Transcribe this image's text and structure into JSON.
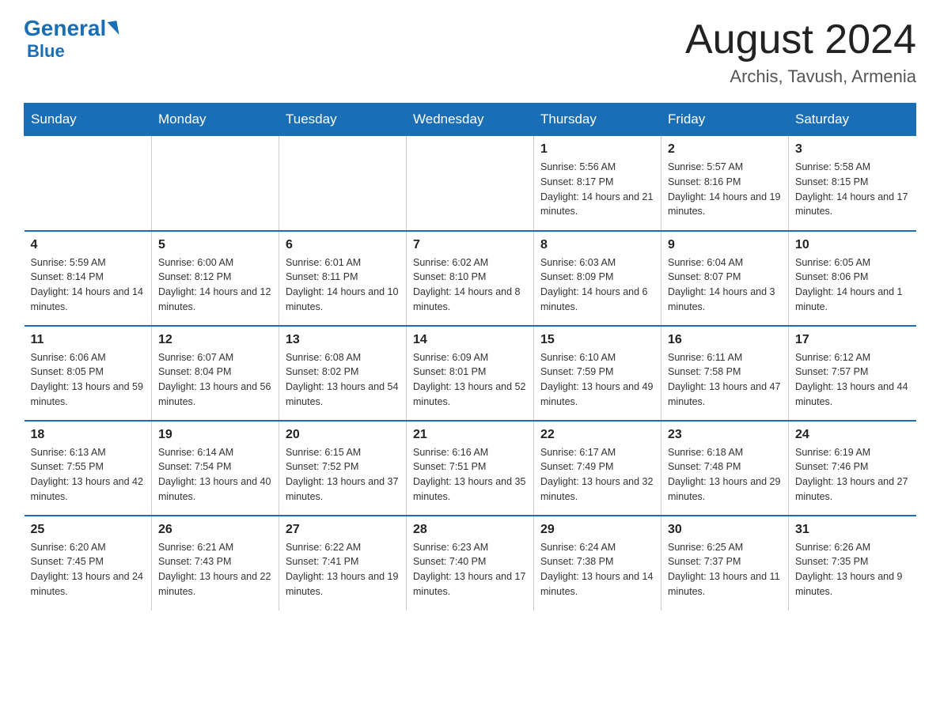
{
  "header": {
    "logo_text": "General",
    "logo_blue": "Blue",
    "month_title": "August 2024",
    "location": "Archis, Tavush, Armenia"
  },
  "days_of_week": [
    "Sunday",
    "Monday",
    "Tuesday",
    "Wednesday",
    "Thursday",
    "Friday",
    "Saturday"
  ],
  "weeks": [
    [
      {
        "day": "",
        "info": ""
      },
      {
        "day": "",
        "info": ""
      },
      {
        "day": "",
        "info": ""
      },
      {
        "day": "",
        "info": ""
      },
      {
        "day": "1",
        "info": "Sunrise: 5:56 AM\nSunset: 8:17 PM\nDaylight: 14 hours and 21 minutes."
      },
      {
        "day": "2",
        "info": "Sunrise: 5:57 AM\nSunset: 8:16 PM\nDaylight: 14 hours and 19 minutes."
      },
      {
        "day": "3",
        "info": "Sunrise: 5:58 AM\nSunset: 8:15 PM\nDaylight: 14 hours and 17 minutes."
      }
    ],
    [
      {
        "day": "4",
        "info": "Sunrise: 5:59 AM\nSunset: 8:14 PM\nDaylight: 14 hours and 14 minutes."
      },
      {
        "day": "5",
        "info": "Sunrise: 6:00 AM\nSunset: 8:12 PM\nDaylight: 14 hours and 12 minutes."
      },
      {
        "day": "6",
        "info": "Sunrise: 6:01 AM\nSunset: 8:11 PM\nDaylight: 14 hours and 10 minutes."
      },
      {
        "day": "7",
        "info": "Sunrise: 6:02 AM\nSunset: 8:10 PM\nDaylight: 14 hours and 8 minutes."
      },
      {
        "day": "8",
        "info": "Sunrise: 6:03 AM\nSunset: 8:09 PM\nDaylight: 14 hours and 6 minutes."
      },
      {
        "day": "9",
        "info": "Sunrise: 6:04 AM\nSunset: 8:07 PM\nDaylight: 14 hours and 3 minutes."
      },
      {
        "day": "10",
        "info": "Sunrise: 6:05 AM\nSunset: 8:06 PM\nDaylight: 14 hours and 1 minute."
      }
    ],
    [
      {
        "day": "11",
        "info": "Sunrise: 6:06 AM\nSunset: 8:05 PM\nDaylight: 13 hours and 59 minutes."
      },
      {
        "day": "12",
        "info": "Sunrise: 6:07 AM\nSunset: 8:04 PM\nDaylight: 13 hours and 56 minutes."
      },
      {
        "day": "13",
        "info": "Sunrise: 6:08 AM\nSunset: 8:02 PM\nDaylight: 13 hours and 54 minutes."
      },
      {
        "day": "14",
        "info": "Sunrise: 6:09 AM\nSunset: 8:01 PM\nDaylight: 13 hours and 52 minutes."
      },
      {
        "day": "15",
        "info": "Sunrise: 6:10 AM\nSunset: 7:59 PM\nDaylight: 13 hours and 49 minutes."
      },
      {
        "day": "16",
        "info": "Sunrise: 6:11 AM\nSunset: 7:58 PM\nDaylight: 13 hours and 47 minutes."
      },
      {
        "day": "17",
        "info": "Sunrise: 6:12 AM\nSunset: 7:57 PM\nDaylight: 13 hours and 44 minutes."
      }
    ],
    [
      {
        "day": "18",
        "info": "Sunrise: 6:13 AM\nSunset: 7:55 PM\nDaylight: 13 hours and 42 minutes."
      },
      {
        "day": "19",
        "info": "Sunrise: 6:14 AM\nSunset: 7:54 PM\nDaylight: 13 hours and 40 minutes."
      },
      {
        "day": "20",
        "info": "Sunrise: 6:15 AM\nSunset: 7:52 PM\nDaylight: 13 hours and 37 minutes."
      },
      {
        "day": "21",
        "info": "Sunrise: 6:16 AM\nSunset: 7:51 PM\nDaylight: 13 hours and 35 minutes."
      },
      {
        "day": "22",
        "info": "Sunrise: 6:17 AM\nSunset: 7:49 PM\nDaylight: 13 hours and 32 minutes."
      },
      {
        "day": "23",
        "info": "Sunrise: 6:18 AM\nSunset: 7:48 PM\nDaylight: 13 hours and 29 minutes."
      },
      {
        "day": "24",
        "info": "Sunrise: 6:19 AM\nSunset: 7:46 PM\nDaylight: 13 hours and 27 minutes."
      }
    ],
    [
      {
        "day": "25",
        "info": "Sunrise: 6:20 AM\nSunset: 7:45 PM\nDaylight: 13 hours and 24 minutes."
      },
      {
        "day": "26",
        "info": "Sunrise: 6:21 AM\nSunset: 7:43 PM\nDaylight: 13 hours and 22 minutes."
      },
      {
        "day": "27",
        "info": "Sunrise: 6:22 AM\nSunset: 7:41 PM\nDaylight: 13 hours and 19 minutes."
      },
      {
        "day": "28",
        "info": "Sunrise: 6:23 AM\nSunset: 7:40 PM\nDaylight: 13 hours and 17 minutes."
      },
      {
        "day": "29",
        "info": "Sunrise: 6:24 AM\nSunset: 7:38 PM\nDaylight: 13 hours and 14 minutes."
      },
      {
        "day": "30",
        "info": "Sunrise: 6:25 AM\nSunset: 7:37 PM\nDaylight: 13 hours and 11 minutes."
      },
      {
        "day": "31",
        "info": "Sunrise: 6:26 AM\nSunset: 7:35 PM\nDaylight: 13 hours and 9 minutes."
      }
    ]
  ]
}
